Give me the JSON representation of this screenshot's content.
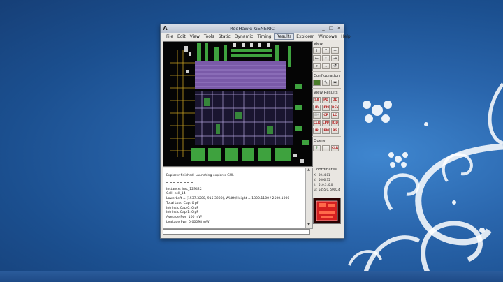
{
  "window": {
    "title": "RedHawk: GENERIC",
    "logo": "A",
    "controls": [
      "_",
      "□",
      "×"
    ]
  },
  "menu": [
    "Explorer",
    "File",
    "Edit",
    "View",
    "Tools",
    "Static",
    "Dynamic",
    "Timing",
    "Results",
    "Explorer",
    "Windows",
    "Help"
  ],
  "panels": {
    "view": {
      "label": "View",
      "buttons": [
        "zoom-in",
        "pan-up",
        "zoom-out",
        "pan-left",
        "fit",
        "pan-right",
        "zoom-area",
        "pan-down",
        "zoom-prev"
      ]
    },
    "configuration": {
      "label": "Configuration",
      "buttons": [
        "layers",
        "config",
        "settings"
      ]
    },
    "view_results": {
      "label": "View Results",
      "buttons": [
        "SA",
        "PD",
        "DD",
        "IR",
        "IPM",
        "DEV",
        "EM",
        "CP",
        "LC",
        "CLR",
        "LPM",
        "IOD",
        "IR",
        "IPM",
        "PG"
      ]
    },
    "query": {
      "label": "Query",
      "buttons": [
        "?",
        "i",
        "CLR"
      ]
    },
    "coordinates": {
      "label": "Coordinates",
      "rows": [
        {
          "key": "X:",
          "value": "3944.81"
        },
        {
          "key": "Y:",
          "value": "5000.35"
        },
        {
          "key": "ll:",
          "value": "510.3, 0.0"
        },
        {
          "key": "ur:",
          "value": "5455.0, 5000.4"
        }
      ]
    }
  },
  "console": {
    "lines": [
      "Explorer finished. Launching explorer GUI.",
      "Instance: inst_129422",
      "Cell: cell_14",
      "LowerLeft = (1537.3200, 915.3200), Width/Height = 1300.1100 / 2500.1000",
      "Total Load Cap:       0 pF",
      "Intrinsic Cap 0:      0 pF",
      "Intrinsic Cap 1:      0 pF",
      "Average Pwr:       100 mW",
      "Leakage Pwr:  0.00098 mW"
    ],
    "command": ""
  },
  "colors": {
    "desktop": "#1f5aa0",
    "accent_red": "#b02222",
    "layout_purple": "#7a5aa8",
    "layout_green": "#3ea23e"
  }
}
